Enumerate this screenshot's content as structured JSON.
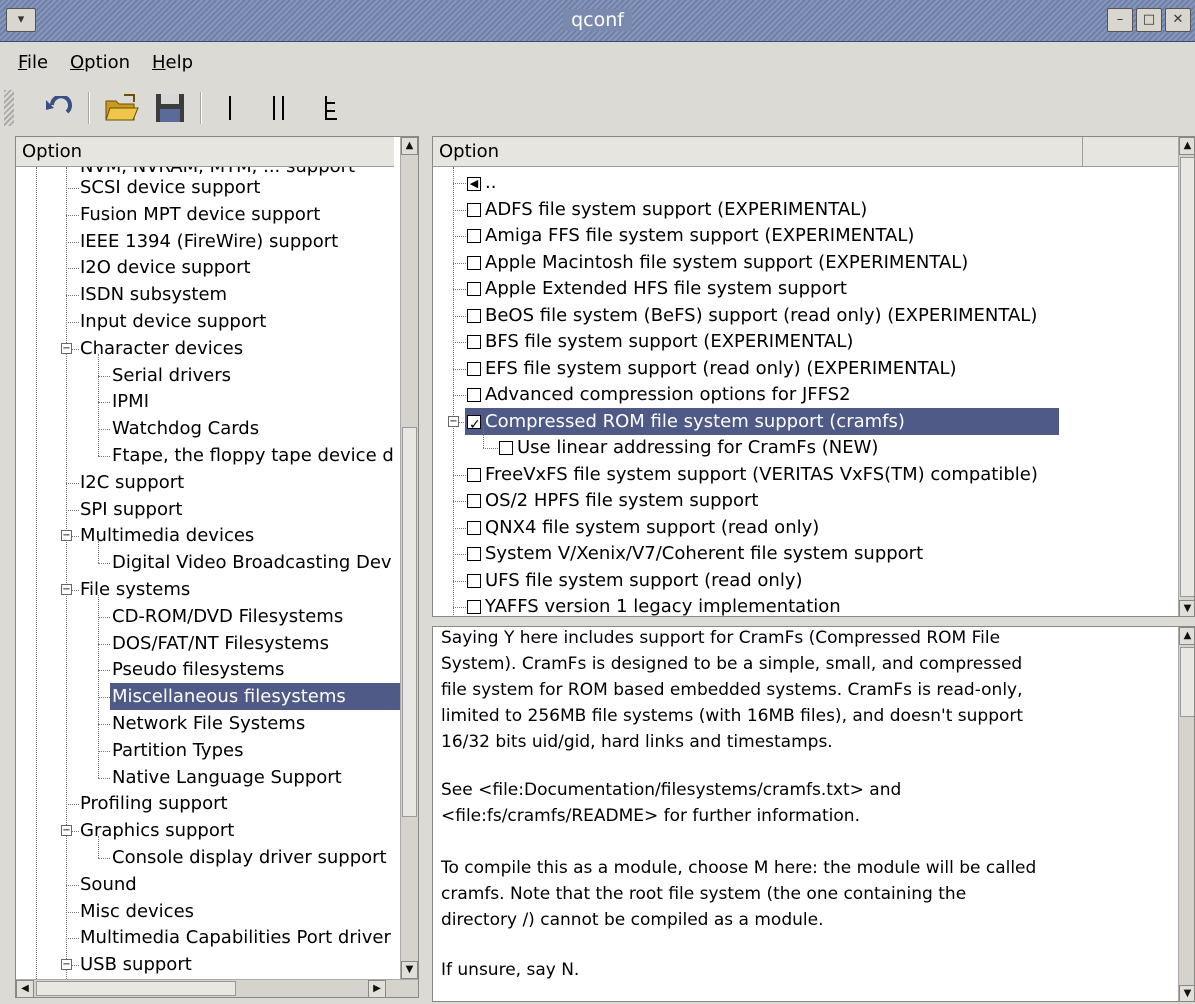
{
  "window": {
    "title": "qconf"
  },
  "menu": [
    {
      "label": "File",
      "accel": "F",
      "rest": "ile"
    },
    {
      "label": "Option",
      "accel": "O",
      "rest": "ption"
    },
    {
      "label": "Help",
      "accel": "H",
      "rest": "elp"
    }
  ],
  "toolbar": {
    "icons": [
      "back-icon",
      "open-folder-icon",
      "save-icon",
      "single-view-icon",
      "split-view-icon",
      "full-view-icon"
    ]
  },
  "left_panel": {
    "header": "Option",
    "partial_top": "NVM, NVRAM, MTM, ... support",
    "items": [
      {
        "label": "SCSI device support",
        "level": 1
      },
      {
        "label": "Fusion MPT device support",
        "level": 1
      },
      {
        "label": "IEEE 1394 (FireWire) support",
        "level": 1
      },
      {
        "label": "I2O device support",
        "level": 1
      },
      {
        "label": "ISDN subsystem",
        "level": 1
      },
      {
        "label": "Input device support",
        "level": 1
      },
      {
        "label": "Character devices",
        "level": 1,
        "expanded": true
      },
      {
        "label": "Serial drivers",
        "level": 2
      },
      {
        "label": "IPMI",
        "level": 2
      },
      {
        "label": "Watchdog Cards",
        "level": 2
      },
      {
        "label": "Ftape, the floppy tape device d",
        "level": 2
      },
      {
        "label": "I2C support",
        "level": 1
      },
      {
        "label": "SPI support",
        "level": 1
      },
      {
        "label": "Multimedia devices",
        "level": 1,
        "expanded": true
      },
      {
        "label": "Digital Video Broadcasting Dev",
        "level": 2
      },
      {
        "label": "File systems",
        "level": 1,
        "expanded": true
      },
      {
        "label": "CD-ROM/DVD Filesystems",
        "level": 2
      },
      {
        "label": "DOS/FAT/NT Filesystems",
        "level": 2
      },
      {
        "label": "Pseudo filesystems",
        "level": 2
      },
      {
        "label": "Miscellaneous filesystems",
        "level": 2,
        "selected": true
      },
      {
        "label": "Network File Systems",
        "level": 2
      },
      {
        "label": "Partition Types",
        "level": 2
      },
      {
        "label": "Native Language Support",
        "level": 2
      },
      {
        "label": "Profiling support",
        "level": 1
      },
      {
        "label": "Graphics support",
        "level": 1,
        "expanded": true
      },
      {
        "label": "Console display driver support",
        "level": 2
      },
      {
        "label": "Sound",
        "level": 1
      },
      {
        "label": "Misc devices",
        "level": 1
      },
      {
        "label": "Multimedia Capabilities Port driver",
        "level": 1
      },
      {
        "label": "USB support",
        "level": 1,
        "expanded": true
      }
    ]
  },
  "right_panel": {
    "header": "Option",
    "items": [
      {
        "label": "..",
        "type": "back",
        "level": 1
      },
      {
        "label": "ADFS file system support (EXPERIMENTAL)",
        "level": 1,
        "checked": false
      },
      {
        "label": "Amiga FFS file system support (EXPERIMENTAL)",
        "level": 1,
        "checked": false
      },
      {
        "label": "Apple Macintosh file system support (EXPERIMENTAL)",
        "level": 1,
        "checked": false
      },
      {
        "label": "Apple Extended HFS file system support",
        "level": 1,
        "checked": false
      },
      {
        "label": "BeOS file system (BeFS) support (read only) (EXPERIMENTAL)",
        "level": 1,
        "checked": false
      },
      {
        "label": "BFS file system support (EXPERIMENTAL)",
        "level": 1,
        "checked": false
      },
      {
        "label": "EFS file system support (read only) (EXPERIMENTAL)",
        "level": 1,
        "checked": false
      },
      {
        "label": "Advanced compression options for JFFS2",
        "level": 1,
        "checked": false
      },
      {
        "label": "Compressed ROM file system support (cramfs)",
        "level": 1,
        "checked": true,
        "selected": true,
        "expanded": true
      },
      {
        "label": "Use linear addressing for CramFs (NEW)",
        "level": 2,
        "checked": false
      },
      {
        "label": "FreeVxFS file system support (VERITAS VxFS(TM) compatible)",
        "level": 1,
        "checked": false
      },
      {
        "label": "OS/2 HPFS file system support",
        "level": 1,
        "checked": false
      },
      {
        "label": "QNX4 file system support (read only)",
        "level": 1,
        "checked": false
      },
      {
        "label": "System V/Xenix/V7/Coherent file system support",
        "level": 1,
        "checked": false
      },
      {
        "label": "UFS file system support (read only)",
        "level": 1,
        "checked": false
      },
      {
        "label": "YAFFS version 1 legacy implementation",
        "level": 1,
        "checked": false
      }
    ]
  },
  "help_text": {
    "p1": "Saying Y here includes support for CramFs (Compressed ROM File\nSystem). CramFs is designed to be a simple, small, and compressed\nfile system for ROM based embedded systems. CramFs is read-only,\nlimited to 256MB file systems (with 16MB files), and doesn't support\n16/32 bits uid/gid, hard links and timestamps.",
    "p2": "See <file:Documentation/filesystems/cramfs.txt> and\n<file:fs/cramfs/README> for further information.",
    "p3": "To compile this as a module, choose M here: the module will be called\ncramfs. Note that the root file system (the one containing the\ndirectory /) cannot be compiled as a module.",
    "p4": "If unsure, say N."
  },
  "colors": {
    "selection": "#4f5a86",
    "titlebar": "#7a89ae"
  }
}
